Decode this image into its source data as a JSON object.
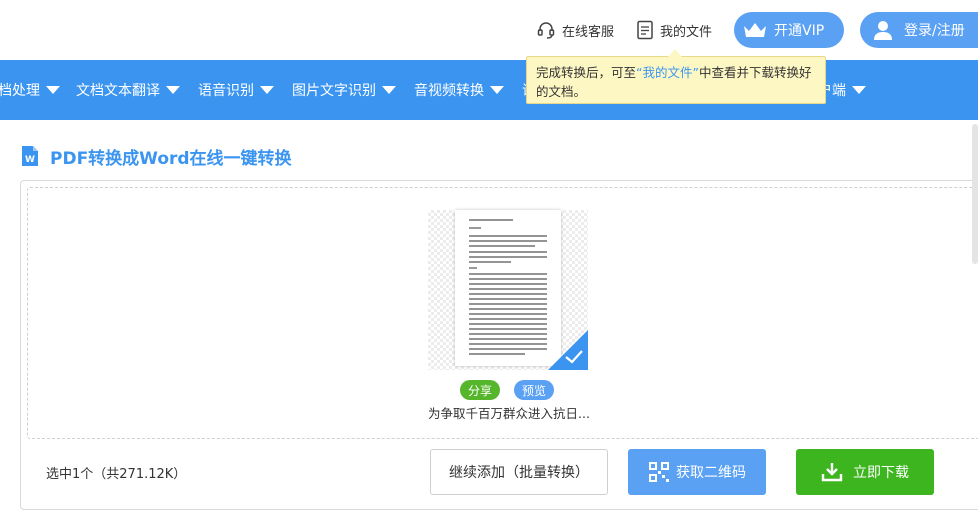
{
  "header": {
    "support_label": "在线客服",
    "myfiles_label": "我的文件",
    "vip_label": "开通VIP",
    "login_label": "登录/注册"
  },
  "nav": {
    "items": [
      {
        "label": "档处理"
      },
      {
        "label": "文档文本翻译"
      },
      {
        "label": "语音识别"
      },
      {
        "label": "图片文字识别"
      },
      {
        "label": "音视频转换"
      },
      {
        "label": "语"
      },
      {
        "label": "户端"
      }
    ]
  },
  "tooltip": {
    "text_before": "完成转换后，可至",
    "highlight": "“我的文件”",
    "text_after": "中查看并下载转换好的文档。"
  },
  "page": {
    "title": "PDF转换成Word在线一键转换"
  },
  "file": {
    "share_label": "分享",
    "preview_label": "预览",
    "name": "为争取千百万群众进入抗日..."
  },
  "footer": {
    "status": "选中1个（共271.12K）",
    "continue_label": "继续添加（批量转换）",
    "qr_label": "获取二维码",
    "download_label": "立即下载"
  },
  "colors": {
    "primary": "#3b95f0",
    "button_blue": "#5aa1f3",
    "green": "#3db51f",
    "tooltip_bg": "#fdf7c4"
  }
}
